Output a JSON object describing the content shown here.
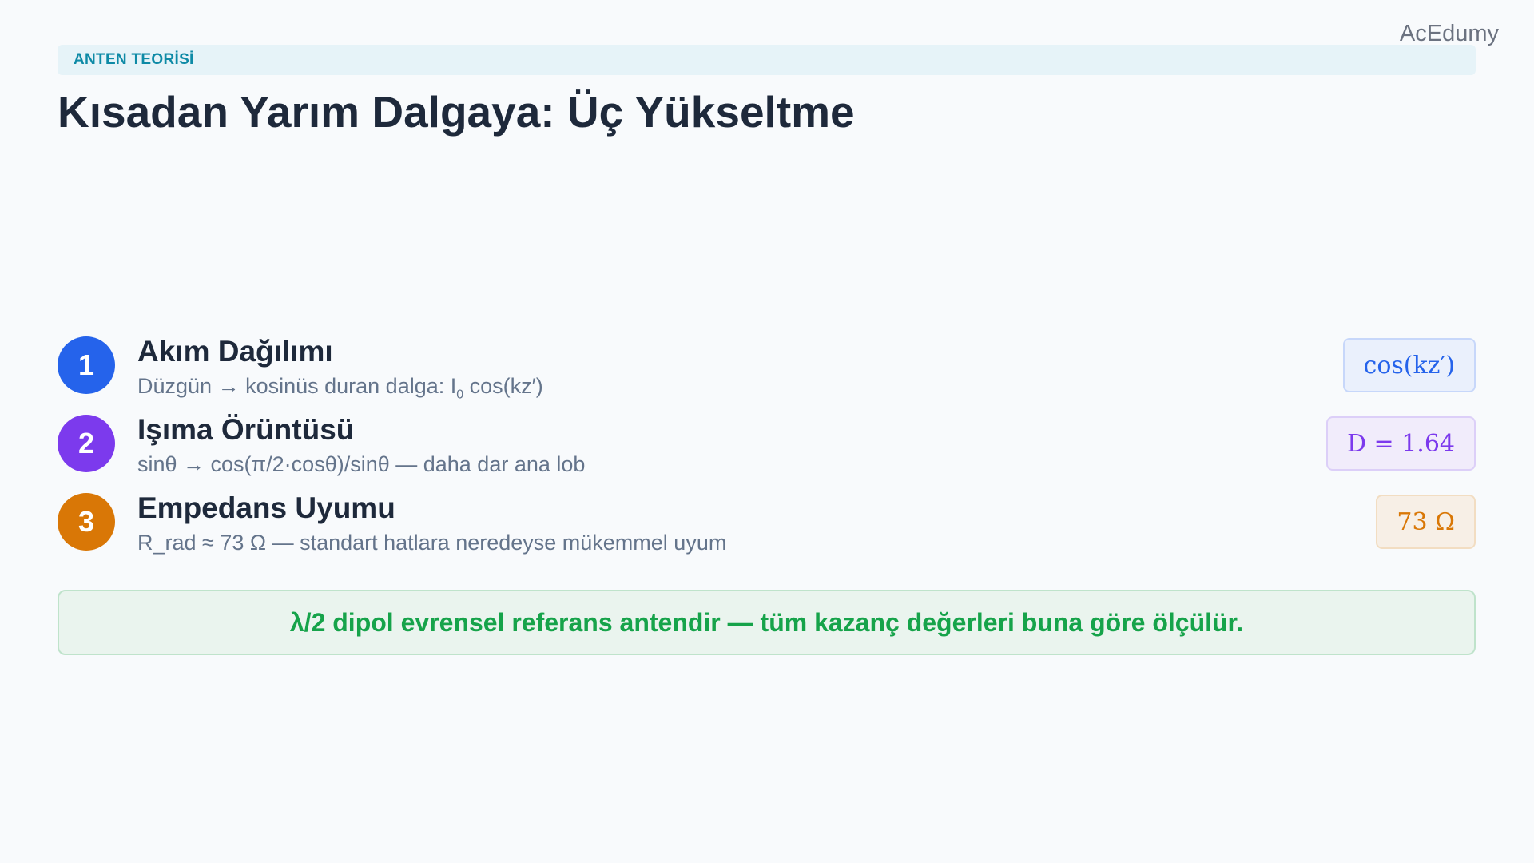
{
  "brand": "AcEdumy",
  "section_tag": "ANTEN TEORİSİ",
  "title": "Kısadan Yarım Dalgaya: Üç Yükseltme",
  "steps": [
    {
      "number": "1",
      "title": "Akım Dağılımı",
      "desc_before": "Düzgün → kosinüs duran dalga: I",
      "desc_sub": "0",
      "desc_after": " cos(kz′)",
      "formula": "cos(kz′)",
      "color": "#2563eb"
    },
    {
      "number": "2",
      "title": "Işıma Örüntüsü",
      "desc": "sinθ → cos(π/2·cosθ)/sinθ — daha dar ana lob",
      "formula": "D = 1.64",
      "color": "#7c3aed"
    },
    {
      "number": "3",
      "title": "Empedans Uyumu",
      "desc": "R_rad ≈ 73 Ω — standart hatlara neredeyse mükemmel uyum",
      "formula": "73 Ω",
      "color": "#d97706"
    }
  ],
  "callout": "λ/2 dipol evrensel referans antendir — tüm kazanç değerleri buna göre ölçülür.",
  "colors": {
    "background": "#f8fafc",
    "tag_text": "#0e8aa6",
    "callout_text": "#16a34a"
  }
}
